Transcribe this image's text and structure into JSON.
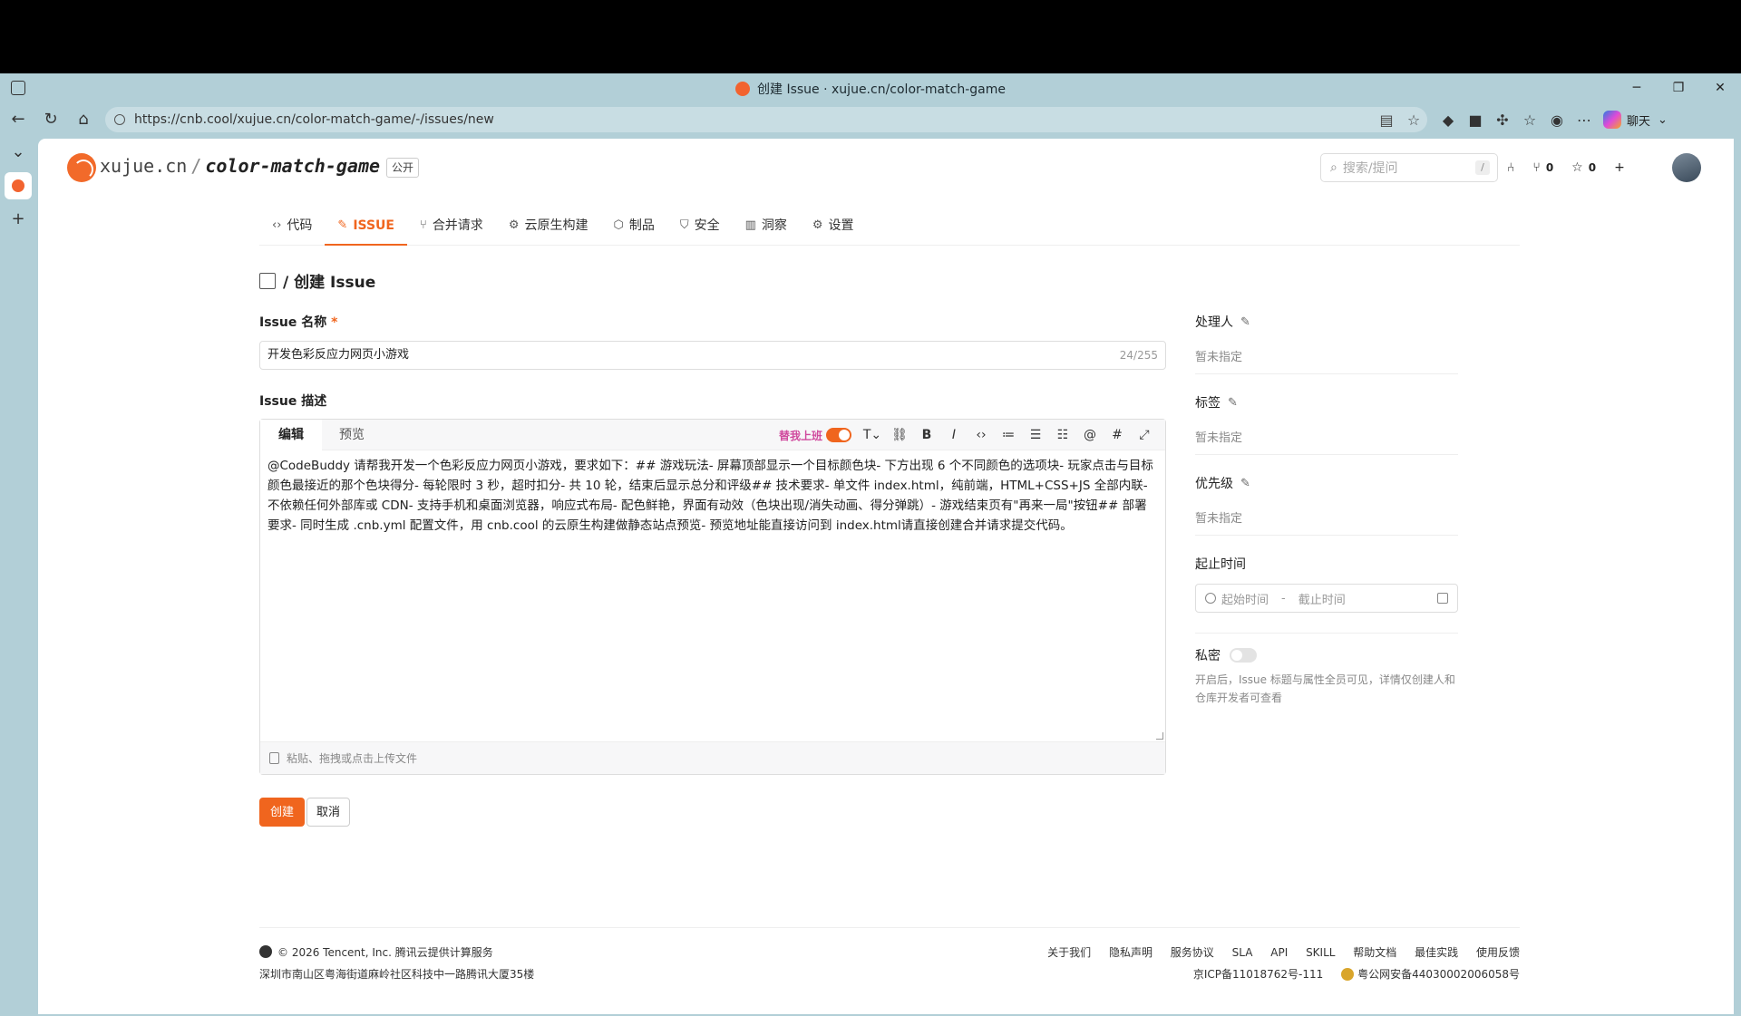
{
  "browser": {
    "window_title": "创建 Issue · xujue.cn/color-match-game",
    "url": "https://cnb.cool/xujue.cn/color-match-game/-/issues/new",
    "chat_label": "聊天"
  },
  "header": {
    "owner": "xujue.cn",
    "separator": "/",
    "repo": "color-match-game",
    "visibility": "公开",
    "search_placeholder": "搜索/提问",
    "search_shortcut": "/",
    "forks_count": "0",
    "stars_count": "0"
  },
  "repo_tabs": [
    {
      "label": "代码",
      "icon": "code-icon"
    },
    {
      "label": "ISSUE",
      "icon": "issue-icon",
      "active": true
    },
    {
      "label": "合并请求",
      "icon": "merge-icon"
    },
    {
      "label": "云原生构建",
      "icon": "build-icon"
    },
    {
      "label": "制品",
      "icon": "package-icon"
    },
    {
      "label": "安全",
      "icon": "shield-icon"
    },
    {
      "label": "洞察",
      "icon": "insight-icon"
    },
    {
      "label": "设置",
      "icon": "gear-icon"
    }
  ],
  "page": {
    "title": "/ 创建 Issue"
  },
  "form": {
    "name_label": "Issue 名称",
    "required_mark": "*",
    "name_value": "开发色彩反应力网页小游戏",
    "name_count": "24/255",
    "desc_label": "Issue 描述",
    "tab_edit": "编辑",
    "tab_preview": "预览",
    "ai_toggle_label": "替我上班",
    "description": "@CodeBuddy 请帮我开发一个色彩反应力网页小游戏，要求如下：## 游戏玩法- 屏幕顶部显示一个目标颜色块- 下方出现 6 个不同颜色的选项块- 玩家点击与目标颜色最接近的那个色块得分- 每轮限时 3 秒，超时扣分- 共 10 轮，结束后显示总分和评级## 技术要求- 单文件 index.html，纯前端，HTML+CSS+JS 全部内联- 不依赖任何外部库或 CDN- 支持手机和桌面浏览器，响应式布局- 配色鲜艳，界面有动效（色块出现/消失动画、得分弹跳）- 游戏结束页有\"再来一局\"按钮## 部署要求- 同时生成 .cnb.yml 配置文件，用 cnb.cool 的云原生构建做静态站点预览- 预览地址能直接访问到 index.html请直接创建合并请求提交代码。",
    "upload_hint": "粘贴、拖拽或点击上传文件",
    "create_button": "创建",
    "cancel_button": "取消"
  },
  "sidebar": {
    "assignee_label": "处理人",
    "assignee_value": "暂未指定",
    "labels_label": "标签",
    "labels_value": "暂未指定",
    "priority_label": "优先级",
    "priority_value": "暂未指定",
    "date_label": "起止时间",
    "start_placeholder": "起始时间",
    "date_separator": "-",
    "end_placeholder": "截止时间",
    "private_label": "私密",
    "private_desc": "开启后，Issue 标题与属性全员可见，详情仅创建人和仓库开发者可查看"
  },
  "footer": {
    "copyright": "© 2026 Tencent, Inc. 腾讯云提供计算服务",
    "address": "深圳市南山区粤海街道麻岭社区科技中一路腾讯大厦35楼",
    "links": [
      "关于我们",
      "隐私声明",
      "服务协议",
      "SLA",
      "API",
      "SKILL",
      "帮助文档",
      "最佳实践",
      "使用反馈"
    ],
    "icp": "京ICP备11018762号-111",
    "police": "粤公网安备44030002006058号"
  },
  "colors": {
    "accent": "#f0651e",
    "browser_bg": "#b2cfd7"
  }
}
